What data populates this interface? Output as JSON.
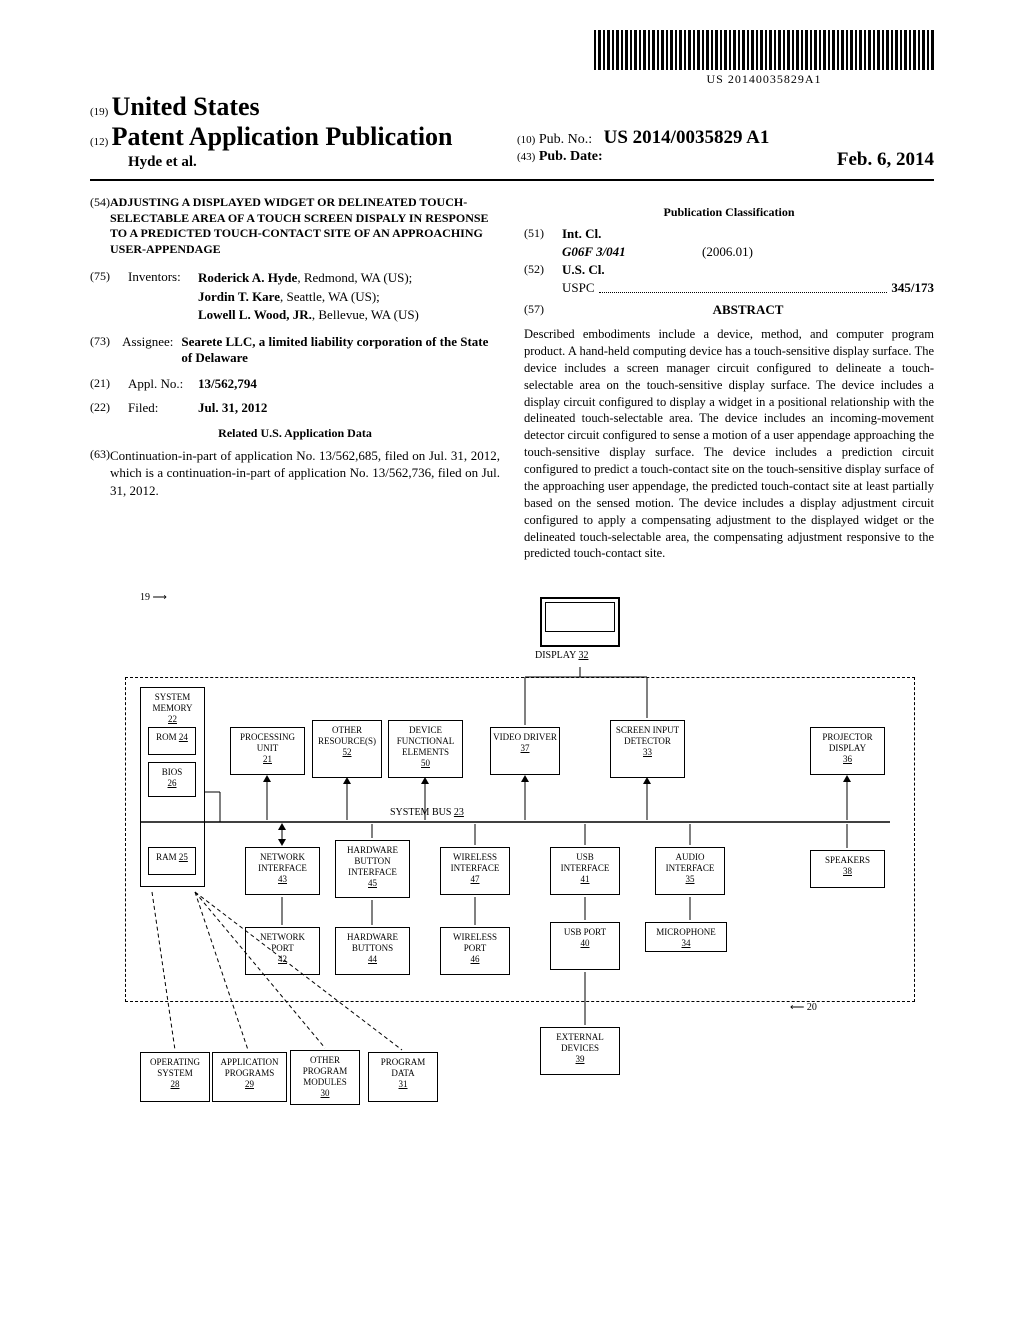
{
  "barcode_text": "US 20140035829A1",
  "header": {
    "num19": "(19)",
    "country": "United States",
    "num12": "(12)",
    "pub_type": "Patent Application Publication",
    "author": "Hyde et al.",
    "num10": "(10)",
    "pub_no_label": "Pub. No.:",
    "pub_no": "US 2014/0035829 A1",
    "num43": "(43)",
    "pub_date_label": "Pub. Date:",
    "pub_date": "Feb. 6, 2014"
  },
  "fields": {
    "n54": "(54)",
    "title": "ADJUSTING A DISPLAYED WIDGET OR DELINEATED TOUCH-SELECTABLE AREA OF A TOUCH SCREEN DISPALY IN RESPONSE TO A PREDICTED TOUCH-CONTACT SITE OF AN APPROACHING USER-APPENDAGE",
    "n75": "(75)",
    "inventors_label": "Inventors:",
    "inv1_name": "Roderick A. Hyde",
    "inv1_loc": ", Redmond, WA (US);",
    "inv2_name": "Jordin T. Kare",
    "inv2_loc": ", Seattle, WA (US);",
    "inv3_name": "Lowell L. Wood, JR.",
    "inv3_loc": ", Bellevue, WA (US)",
    "n73": "(73)",
    "assignee_label": "Assignee:",
    "assignee": "Searete LLC, a limited liability corporation of the State of Delaware",
    "n21": "(21)",
    "appl_no_label": "Appl. No.:",
    "appl_no": "13/562,794",
    "n22": "(22)",
    "filed_label": "Filed:",
    "filed": "Jul. 31, 2012",
    "related_title": "Related U.S. Application Data",
    "n63": "(63)",
    "related": "Continuation-in-part of application No. 13/562,685, filed on Jul. 31, 2012, which is a continuation-in-part of application No. 13/562,736, filed on Jul. 31, 2012.",
    "class_title": "Publication Classification",
    "n51": "(51)",
    "int_cl_label": "Int. Cl.",
    "int_cl": "G06F 3/041",
    "int_cl_year": "(2006.01)",
    "n52": "(52)",
    "us_cl_label": "U.S. Cl.",
    "uspc_label": "USPC",
    "uspc": "345/173",
    "n57": "(57)",
    "abstract_label": "ABSTRACT",
    "abstract": "Described embodiments include a device, method, and computer program product. A hand-held computing device has a touch-sensitive display surface. The device includes a screen manager circuit configured to delineate a touch-selectable area on the touch-sensitive display surface. The device includes a display circuit configured to display a widget in a positional relationship with the delineated touch-selectable area. The device includes an incoming-movement detector circuit configured to sense a motion of a user appendage approaching the touch-sensitive display surface. The device includes a prediction circuit configured to predict a touch-contact site on the touch-sensitive display surface of the approaching user appendage, the predicted touch-contact site at least partially based on the sensed motion. The device includes a display adjustment circuit configured to apply a compensating adjustment to the displayed widget or the delineated touch-selectable area, the compensating adjustment responsive to the predicted touch-contact site."
  },
  "diagram": {
    "ref19": "19",
    "ref20": "20",
    "display": "DISPLAY",
    "display_num": "32",
    "sys_mem": "SYSTEM MEMORY",
    "sys_mem_num": "22",
    "rom": "ROM",
    "rom_num": "24",
    "bios": "BIOS",
    "bios_num": "26",
    "ram": "RAM",
    "ram_num": "25",
    "proc": "PROCESSING UNIT",
    "proc_num": "21",
    "other_res": "OTHER RESOURCE(S)",
    "other_res_num": "52",
    "dev_func": "DEVICE FUNCTIONAL ELEMENTS",
    "dev_func_num": "50",
    "vid_drv": "VIDEO DRIVER",
    "vid_drv_num": "37",
    "scr_inp": "SCREEN INPUT DETECTOR",
    "scr_inp_num": "33",
    "proj": "PROJECTOR DISPLAY",
    "proj_num": "36",
    "sys_bus": "SYSTEM BUS",
    "sys_bus_num": "23",
    "net_if": "NETWORK INTERFACE",
    "net_if_num": "43",
    "hw_btn_if": "HARDWARE BUTTON INTERFACE",
    "hw_btn_if_num": "45",
    "wl_if": "WIRELESS INTERFACE",
    "wl_if_num": "47",
    "usb_if": "USB INTERFACE",
    "usb_if_num": "41",
    "aud_if": "AUDIO INTERFACE",
    "aud_if_num": "35",
    "spk": "SPEAKERS",
    "spk_num": "38",
    "net_port": "NETWORK PORT",
    "net_port_num": "42",
    "hw_btn": "HARDWARE BUTTONS",
    "hw_btn_num": "44",
    "wl_port": "WIRELESS PORT",
    "wl_port_num": "46",
    "usb_port": "USB PORT",
    "usb_port_num": "40",
    "mic": "MICROPHONE",
    "mic_num": "34",
    "ext_dev": "EXTERNAL DEVICES",
    "ext_dev_num": "39",
    "os": "OPERATING SYSTEM",
    "os_num": "28",
    "app": "APPLICATION PROGRAMS",
    "app_num": "29",
    "opm": "OTHER PROGRAM MODULES",
    "opm_num": "30",
    "pdata": "PROGRAM DATA",
    "pdata_num": "31"
  }
}
